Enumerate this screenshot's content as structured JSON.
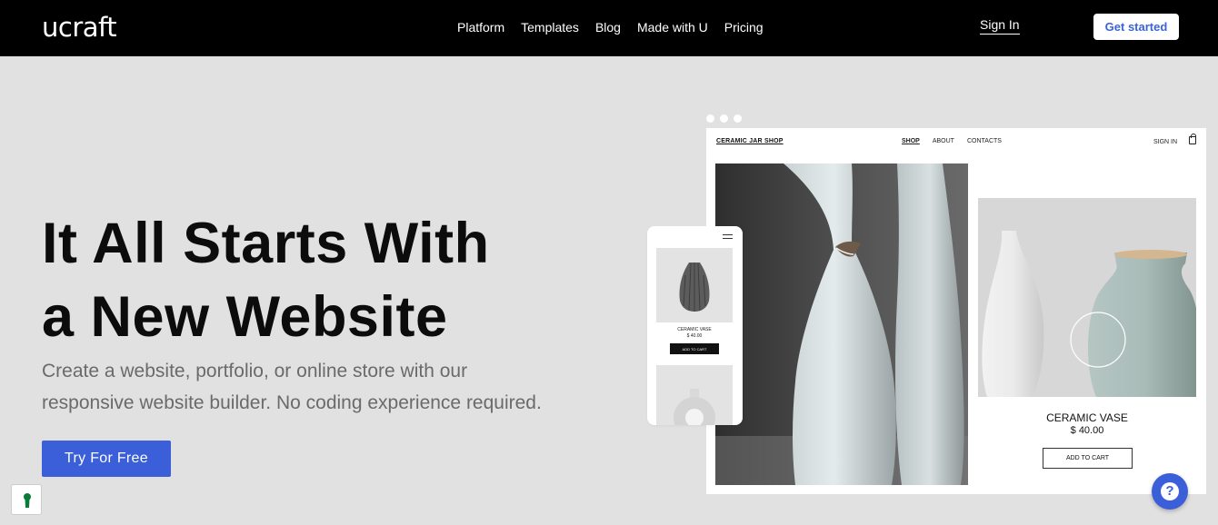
{
  "header": {
    "logo": "ucraft",
    "nav": [
      "Platform",
      "Templates",
      "Blog",
      "Made with U",
      "Pricing"
    ],
    "sign_in": "Sign In",
    "get_started": "Get started"
  },
  "hero": {
    "title_line1": "It All Starts With",
    "title_line2": "a New Website",
    "subtitle_line1": "Create a website, portfolio, or online store with our",
    "subtitle_line2": "responsive website builder. No coding experience required.",
    "cta": "Try For Free"
  },
  "mockup": {
    "shop_name": "CERAMIC JAR SHOP",
    "nav": [
      "SHOP",
      "ABOUT",
      "CONTACTS"
    ],
    "sign_in": "SIGN IN",
    "product_name": "CERAMIC VASE",
    "product_price": "$ 40.00",
    "add_to_cart": "ADD TO CART"
  },
  "phone": {
    "product_name": "CERAMIC VASE",
    "product_price": "$ 40.00",
    "add_to_cart": "ADD TO CART"
  },
  "widgets": {
    "help_icon": "question-icon",
    "cookie_icon": "keyhole-icon"
  },
  "colors": {
    "accent": "#3a5fd9",
    "header_bg": "#000000",
    "page_bg": "#e1e1e1"
  }
}
